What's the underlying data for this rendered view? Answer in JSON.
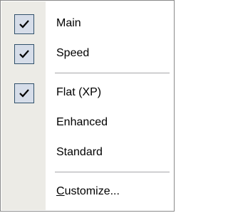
{
  "menu": {
    "items": [
      {
        "label": "Main",
        "checked": true
      },
      {
        "label": "Speed",
        "checked": true
      },
      {
        "label": "Flat (XP)",
        "checked": true
      },
      {
        "label": "Enhanced",
        "checked": false
      },
      {
        "label": "Standard",
        "checked": false
      },
      {
        "label_mnemonic": "C",
        "label_rest": "ustomize...",
        "checked": false
      }
    ]
  },
  "colors": {
    "gutter": "#ecebe6",
    "check_box_fill": "#d6dde9",
    "check_box_border": "#31516b",
    "separator": "#a7a6aa"
  },
  "icons": {
    "check": "checkmark-icon"
  }
}
